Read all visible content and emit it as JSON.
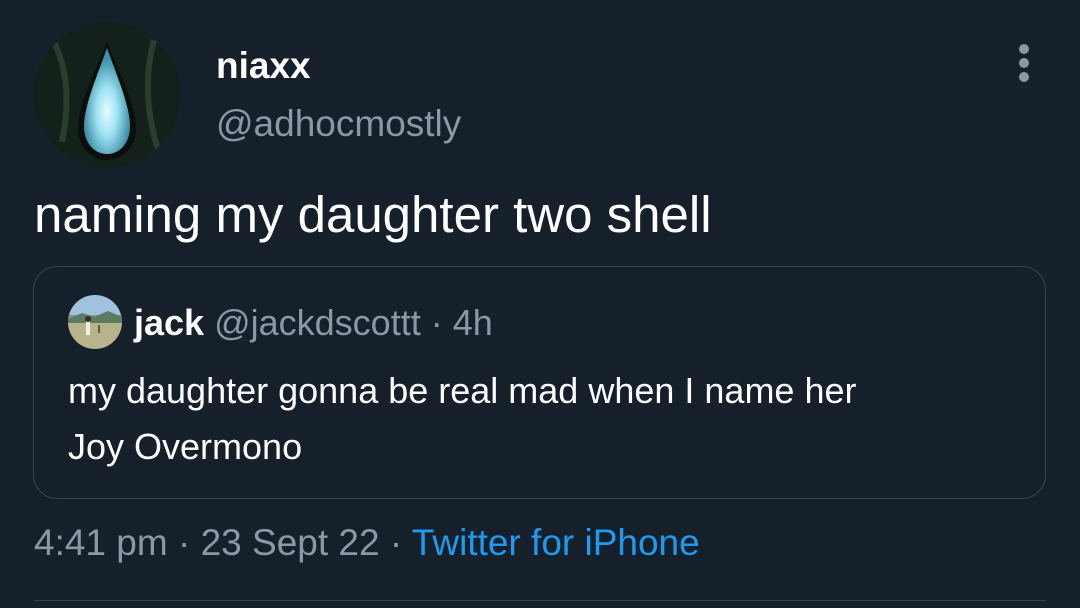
{
  "colors": {
    "background": "#15202b",
    "primary_text": "#ffffff",
    "secondary_text": "#8b98a5",
    "link": "#1d9bf0",
    "border": "#38444d"
  },
  "tweet": {
    "author": {
      "display_name": "niaxx",
      "handle": "@adhocmostly",
      "avatar_icon": "glowing-teardrop-avatar"
    },
    "more_icon": "more-options-icon",
    "text": "naming my daughter two shell",
    "quoted_tweet": {
      "author_name": "jack",
      "author_handle": "@jackdscottt",
      "separator": " · ",
      "time_ago": "4h",
      "avatar_icon": "landscape-avatar",
      "text_lines": [
        "my daughter gonna be real mad when I name her",
        "Joy Overmono"
      ]
    },
    "footer": {
      "time": "4:41 pm",
      "separator1": " · ",
      "date": "23 Sept 22",
      "separator2": " · ",
      "source": "Twitter for iPhone"
    }
  }
}
